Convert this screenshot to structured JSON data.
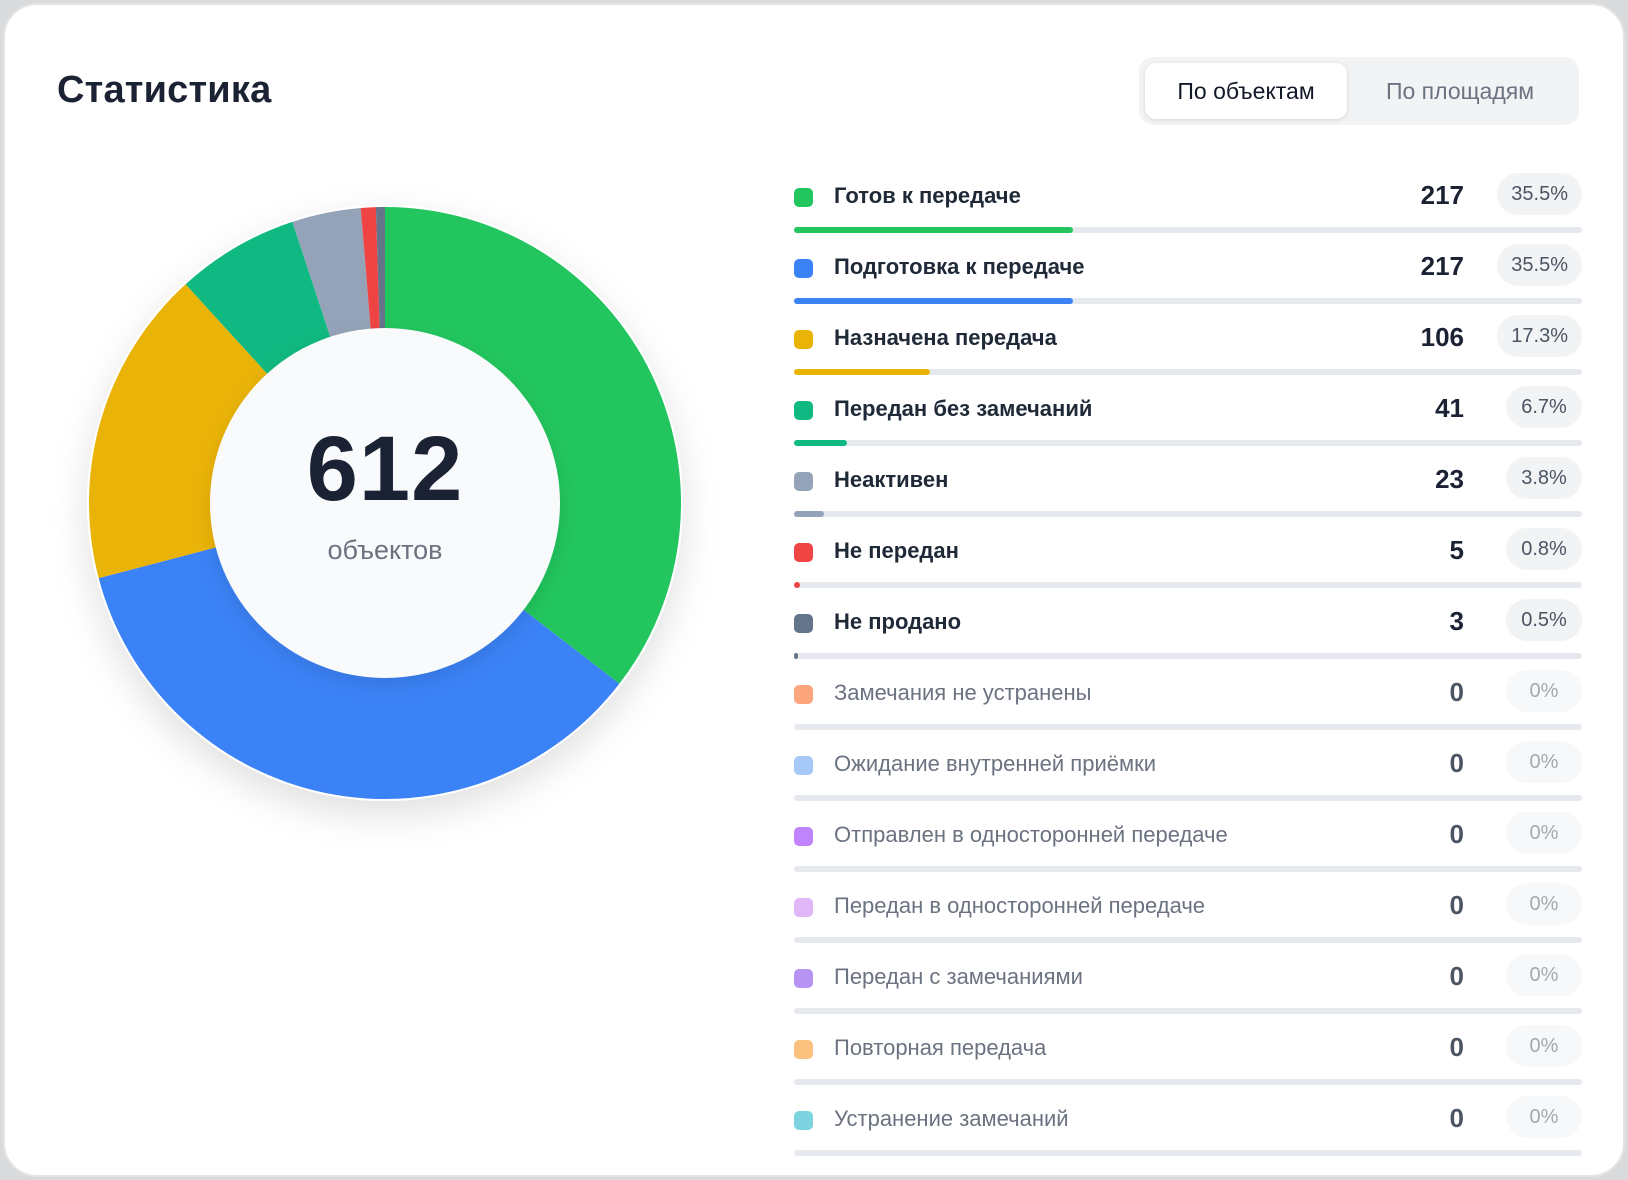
{
  "header": {
    "title": "Статистика"
  },
  "tabs": [
    {
      "label": "По объектам",
      "active": true
    },
    {
      "label": "По площадям",
      "active": false
    }
  ],
  "chart_center": {
    "total": "612",
    "unit": "объектов"
  },
  "chart_data": {
    "type": "pie",
    "total": 612,
    "unit": "объектов",
    "categories": [
      "Готов к передаче",
      "Подготовка к передаче",
      "Назначена передача",
      "Передан без замечаний",
      "Неактивен",
      "Не передан",
      "Не продано",
      "Замечания не устранены",
      "Ожидание внутренней приёмки",
      "Отправлен в односторонней передаче",
      "Передан в односторонней передаче",
      "Передан с замечаниями",
      "Повторная передача",
      "Устранение замечаний"
    ],
    "values": [
      217,
      217,
      106,
      41,
      23,
      5,
      3,
      0,
      0,
      0,
      0,
      0,
      0,
      0
    ],
    "percents": [
      "35.5%",
      "35.5%",
      "17.3%",
      "6.7%",
      "3.8%",
      "0.8%",
      "0.5%",
      "0%",
      "0%",
      "0%",
      "0%",
      "0%",
      "0%",
      "0%"
    ],
    "colors": [
      "#22c55e",
      "#3b82f6",
      "#eab308",
      "#10b981",
      "#94a3b8",
      "#ef4444",
      "#64748b",
      "#fda67e",
      "#a5c8f6",
      "#c084fc",
      "#e0b8f7",
      "#b794f4",
      "#fbc17e",
      "#7dd3e0"
    ]
  }
}
